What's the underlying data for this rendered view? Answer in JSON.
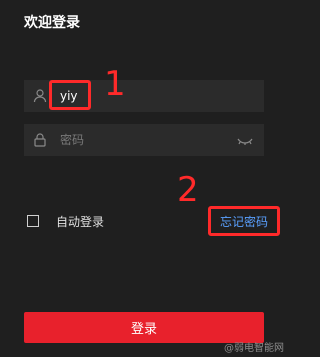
{
  "page": {
    "title": "欢迎登录"
  },
  "username": {
    "value": "yiy"
  },
  "password": {
    "placeholder": "密码"
  },
  "options": {
    "auto_login_label": "自动登录",
    "forgot_password_label": "忘记密码"
  },
  "login_button": {
    "label": "登录"
  },
  "annotations": {
    "one": "1",
    "two": "2"
  },
  "watermark": "@弱电智能网",
  "colors": {
    "background": "#1f1f1f",
    "field": "#2b2b2b",
    "accent_red": "#e8212c",
    "annotation_red": "#ff2a2a",
    "link_blue": "#5aa0ff"
  }
}
